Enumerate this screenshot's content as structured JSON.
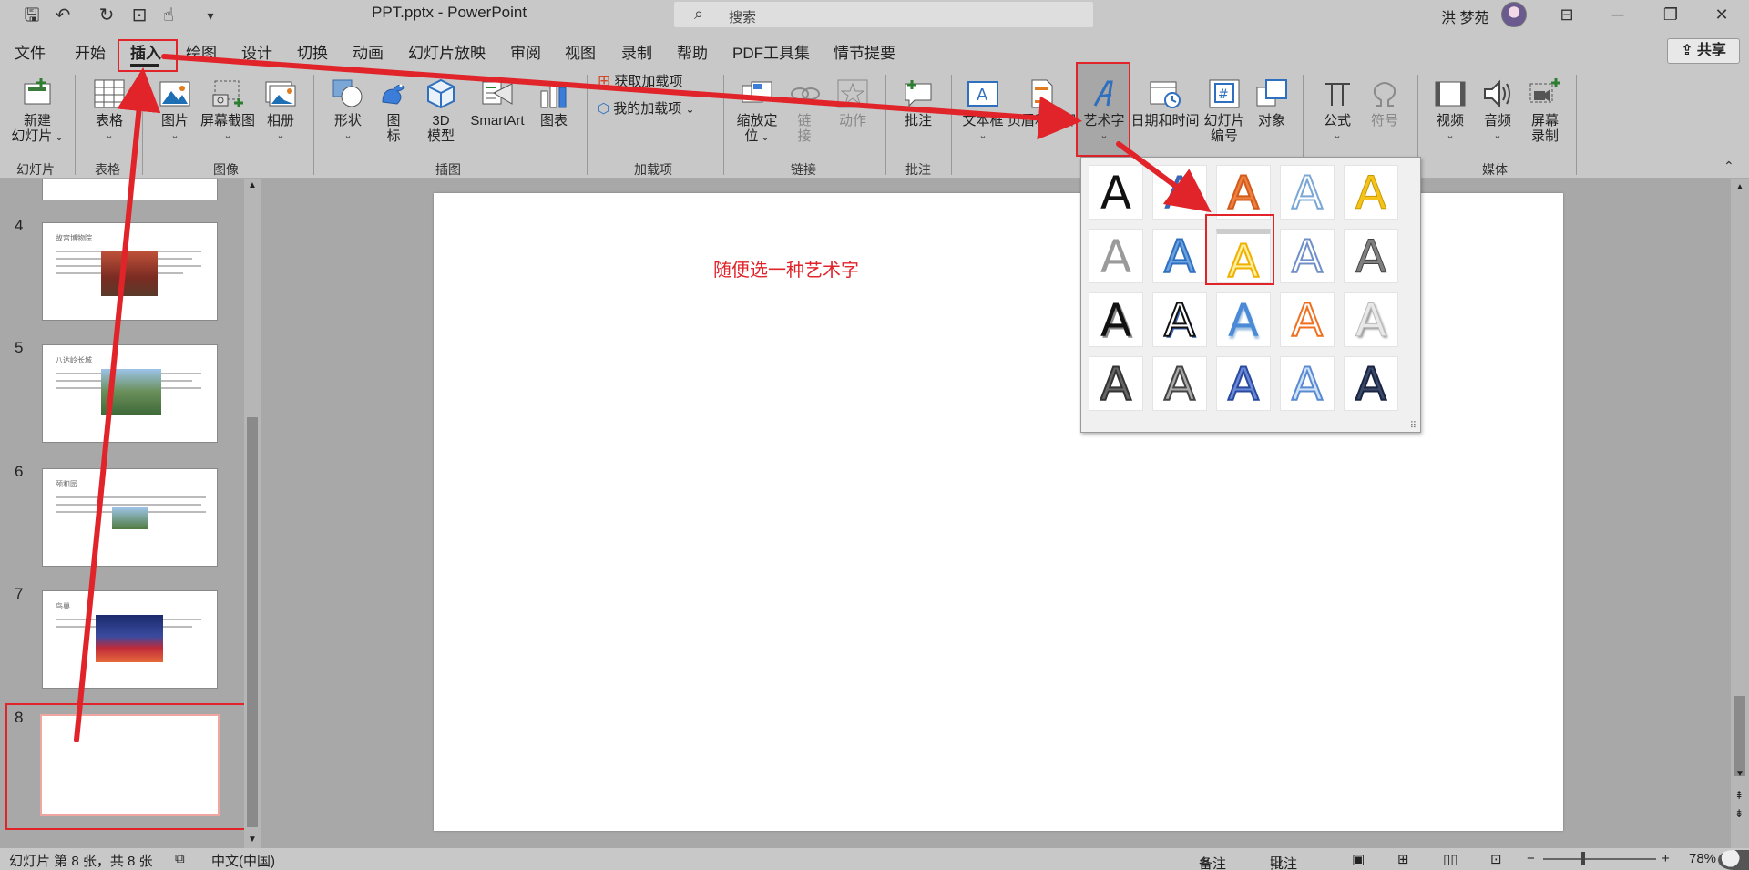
{
  "titlebar": {
    "doc_title": "PPT.pptx  -  PowerPoint",
    "search_placeholder": "搜索",
    "user_name": "洪 梦苑",
    "quick_access": [
      "save-icon",
      "undo-icon",
      "redo-icon",
      "present-icon",
      "touch-icon",
      "customize-icon"
    ]
  },
  "menu": {
    "tabs": [
      "文件",
      "开始",
      "插入",
      "绘图",
      "设计",
      "切换",
      "动画",
      "幻灯片放映",
      "审阅",
      "视图",
      "录制",
      "帮助",
      "PDF工具集",
      "情节提要"
    ],
    "active_tab": "插入",
    "share_label": "共享"
  },
  "ribbon": {
    "new_slide": "新建\n幻灯片",
    "table": "表格",
    "picture": "图片",
    "screenshot": "屏幕截图",
    "album": "相册",
    "shapes": "形状",
    "icons": "图\n标",
    "model3d": "3D\n模型",
    "smartart": "SmartArt",
    "chart": "图表",
    "get_addins": "获取加载项",
    "my_addins": "我的加载项",
    "zoom": "缩放定\n位",
    "link": "链\n接",
    "action": "动作",
    "comment": "批注",
    "textbox": "文本框",
    "header_footer": "页眉和页脚",
    "wordart": "艺术字",
    "datetime": "日期和时间",
    "slide_number": "幻灯片\n编号",
    "object": "对象",
    "equation": "公式",
    "symbol": "符号",
    "video": "视频",
    "audio": "音频",
    "screen_record": "屏幕\n录制",
    "groups": {
      "slides": "幻灯片",
      "tables": "表格",
      "images": "图像",
      "illustrations": "插图",
      "addins": "加载项",
      "links": "链接",
      "comments": "批注",
      "media": "媒体"
    }
  },
  "slides": [
    {
      "num": "4",
      "title": "故宫博物院"
    },
    {
      "num": "5",
      "title": "八达岭长城"
    },
    {
      "num": "6",
      "title": "颐和园"
    },
    {
      "num": "7",
      "title": "鸟巢"
    },
    {
      "num": "8",
      "title": ""
    }
  ],
  "annotation": "随便选一种艺术字",
  "wordart_letter": "A",
  "status": {
    "slide_info": "幻灯片 第 8 张，共 8 张",
    "language": "中文(中国)",
    "notes": "备注",
    "comments": "批注",
    "zoom": "78%"
  },
  "colors": {
    "annotation_red": "#e0242a",
    "background": "#a8a8a8"
  }
}
